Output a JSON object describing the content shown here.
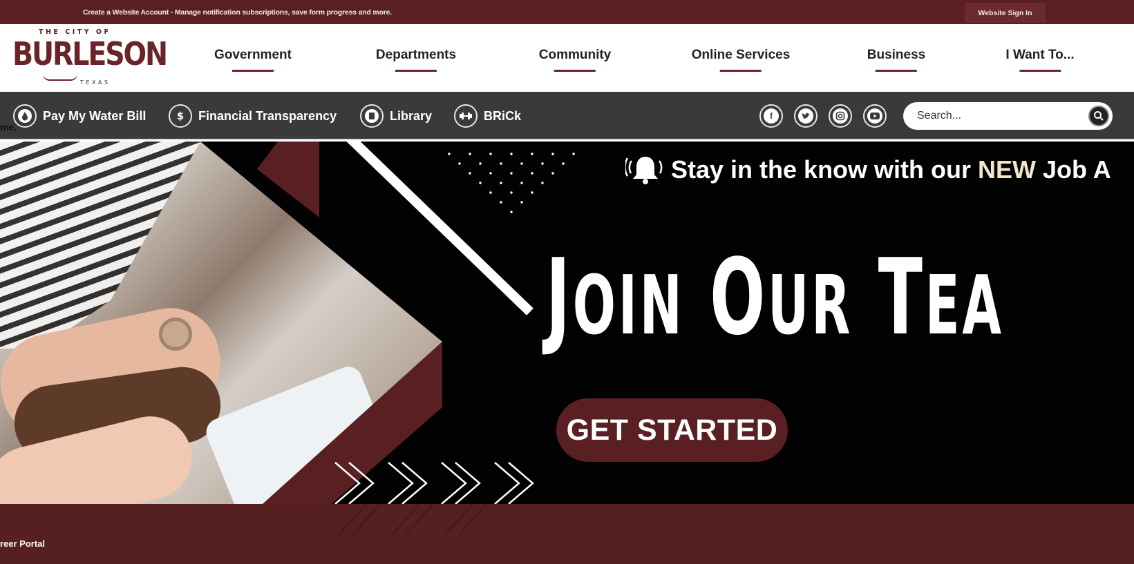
{
  "topbar": {
    "message": "Create a Website Account - Manage notification subscriptions, save form progress and more.",
    "sign_in": "Website Sign In"
  },
  "logo": {
    "line1": "THE CITY OF",
    "name": "BURLESON",
    "state": "TEXAS"
  },
  "nav": {
    "items": [
      {
        "label": "Government"
      },
      {
        "label": "Departments"
      },
      {
        "label": "Community"
      },
      {
        "label": "Online Services"
      },
      {
        "label": "Business"
      },
      {
        "label": "I Want To..."
      }
    ]
  },
  "quicklinks": [
    {
      "label": "Pay My Water Bill",
      "icon": "water-drop-icon"
    },
    {
      "label": "Financial Transparency",
      "icon": "dollar-icon"
    },
    {
      "label": "Library",
      "icon": "book-icon"
    },
    {
      "label": "BRiCk",
      "icon": "dumbbell-icon"
    }
  ],
  "social": [
    "facebook-icon",
    "twitter-icon",
    "instagram-icon",
    "youtube-icon"
  ],
  "search": {
    "placeholder": "Search..."
  },
  "cutoff_text": "me.",
  "hero": {
    "alert_prefix": "Stay in the know with our ",
    "alert_new": "NEW",
    "alert_suffix": " Job A",
    "headline_j": "J",
    "headline_oin": "OIN",
    "headline_o": "O",
    "headline_ur": "UR",
    "headline_t": "T",
    "headline_ea": "EA",
    "cta": "GET STARTED"
  },
  "band": {
    "portal": "reer Portal"
  },
  "colors": {
    "maroon": "#5a1f22",
    "dark_gray": "#3a3a3a",
    "cream": "#f3e7c8"
  }
}
